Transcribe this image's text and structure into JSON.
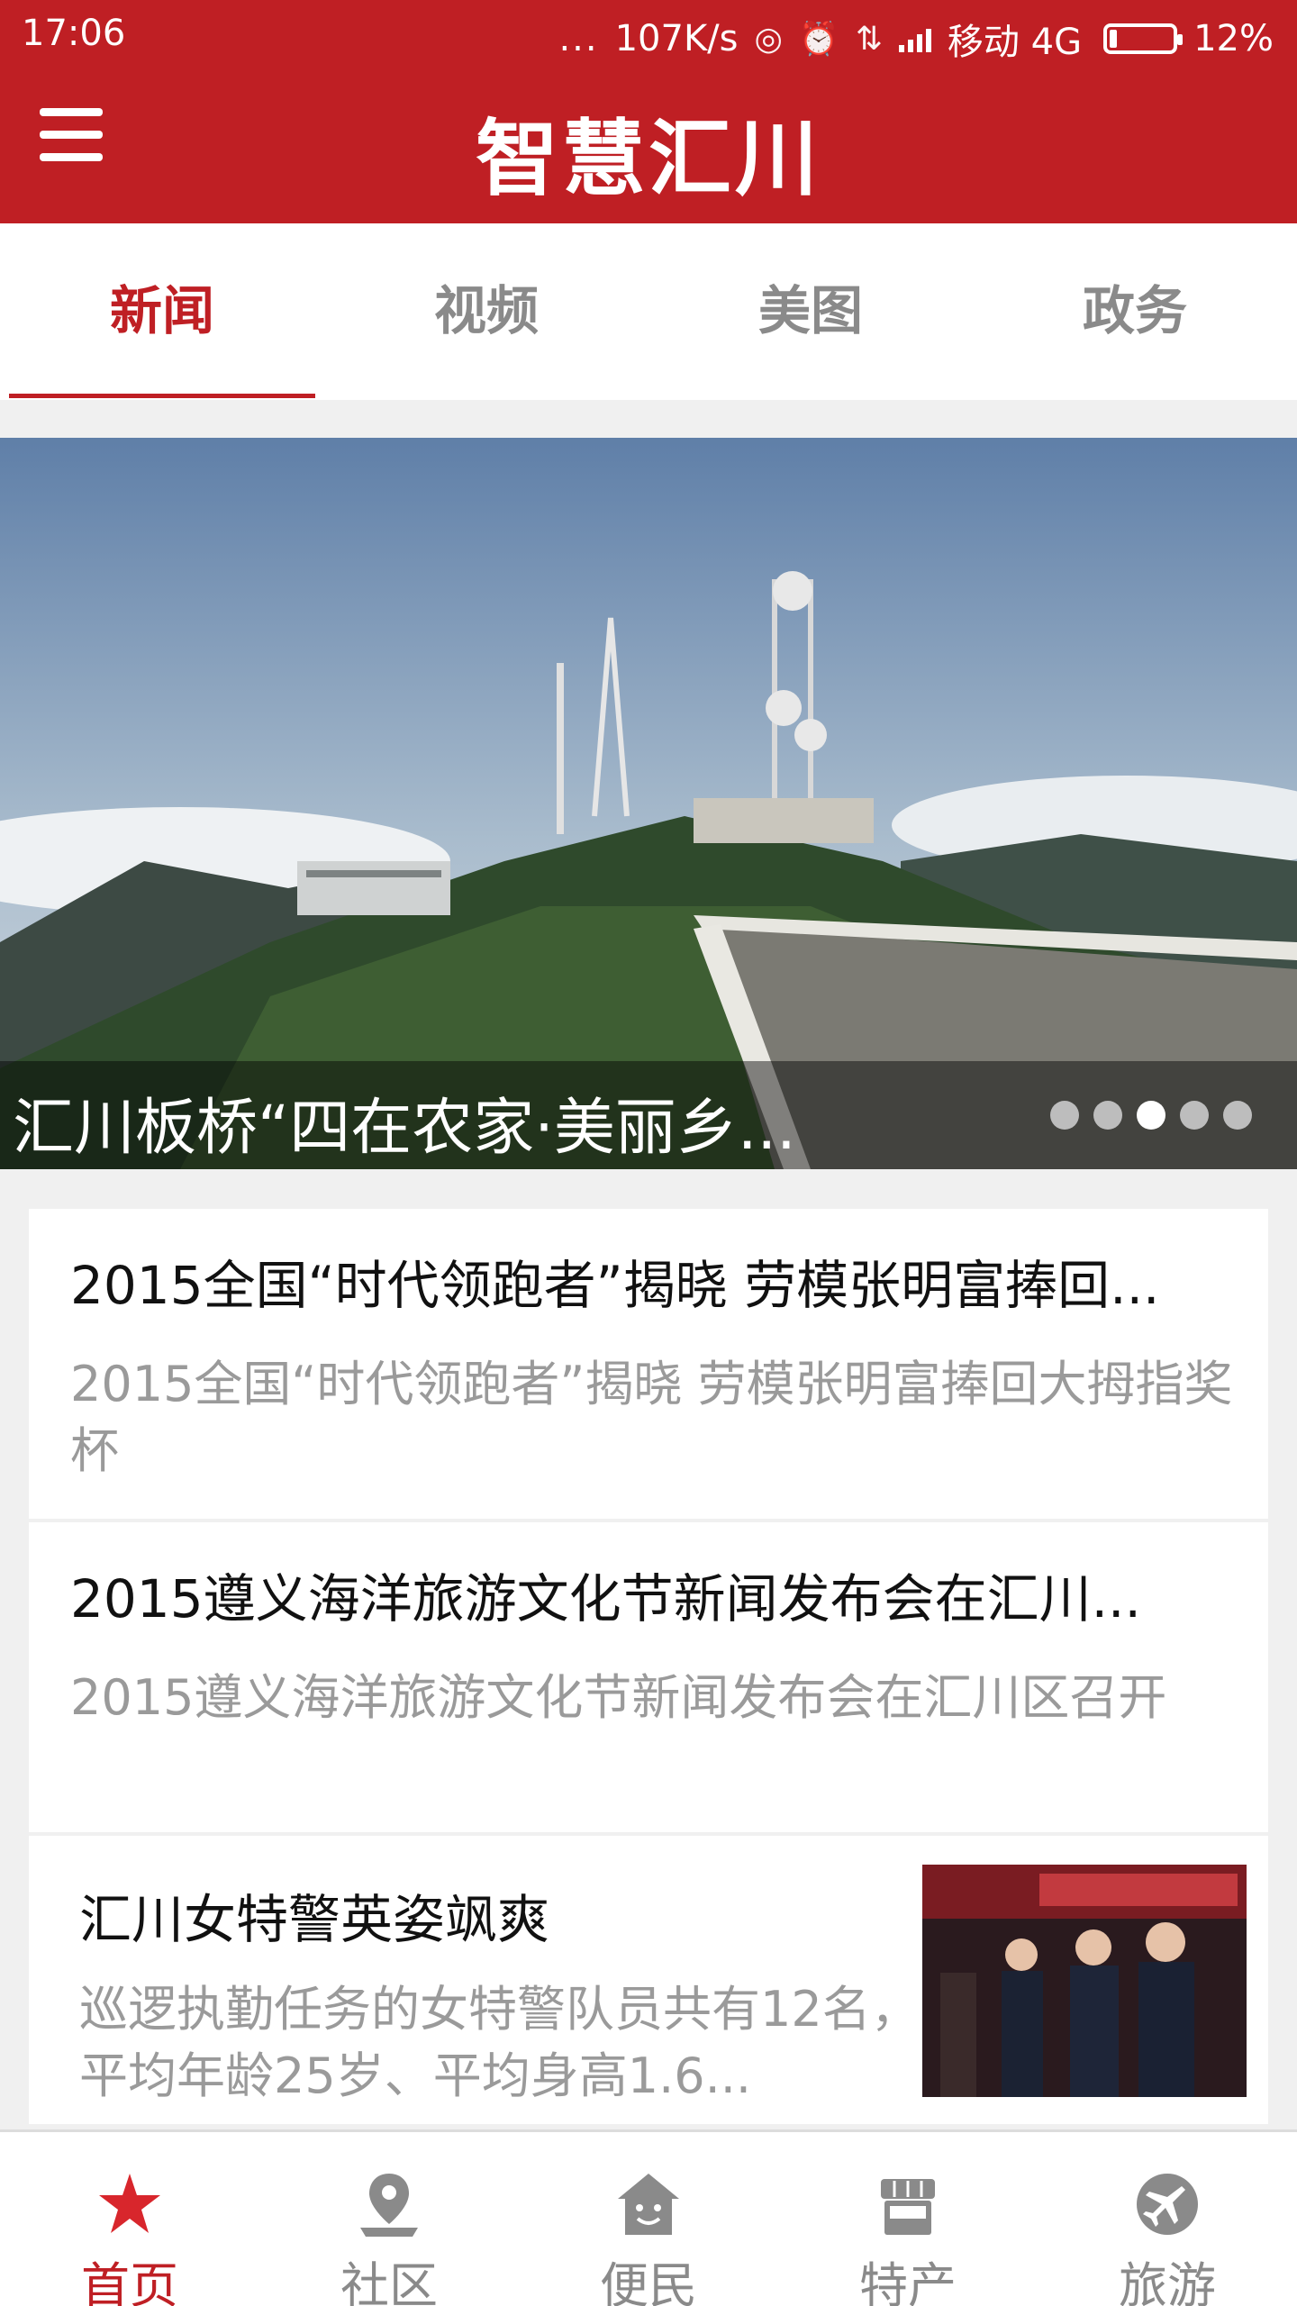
{
  "status_bar": {
    "time": "17:06",
    "dots": "...",
    "net_speed": "107K/s",
    "carrier": "移动 4G",
    "battery": "12%",
    "battery_level": 0.12
  },
  "header": {
    "title": "智慧汇川"
  },
  "tabs": [
    {
      "label": "新闻",
      "active": true
    },
    {
      "label": "视频",
      "active": false
    },
    {
      "label": "美图",
      "active": false
    },
    {
      "label": "政务",
      "active": false
    }
  ],
  "banner": {
    "caption": "汇川板桥“四在农家·美丽乡...",
    "page_count": 5,
    "active_page": 3
  },
  "news": [
    {
      "title": "2015全国“时代领跑者”揭晓 劳模张明富捧回...",
      "summary": "2015全国“时代领跑者”揭晓 劳模张明富捧回大拇指奖杯"
    },
    {
      "title": "2015遵义海洋旅游文化节新闻发布会在汇川...",
      "summary": "2015遵义海洋旅游文化节新闻发布会在汇川区召开"
    },
    {
      "title": "汇川女特警英姿飒爽",
      "summary": "巡逻执勤任务的女特警队员共有12名，平均年龄25岁、平均身高1.6..."
    }
  ],
  "bottom_nav": [
    {
      "label": "首页",
      "icon": "home-star-icon",
      "active": true
    },
    {
      "label": "社区",
      "icon": "map-pin-icon",
      "active": false
    },
    {
      "label": "便民",
      "icon": "house-smile-icon",
      "active": false
    },
    {
      "label": "特产",
      "icon": "shop-icon",
      "active": false
    },
    {
      "label": "旅游",
      "icon": "airplane-icon",
      "active": false
    }
  ],
  "colors": {
    "brand": "#bf1f24",
    "inactive": "#8a8a8a"
  }
}
